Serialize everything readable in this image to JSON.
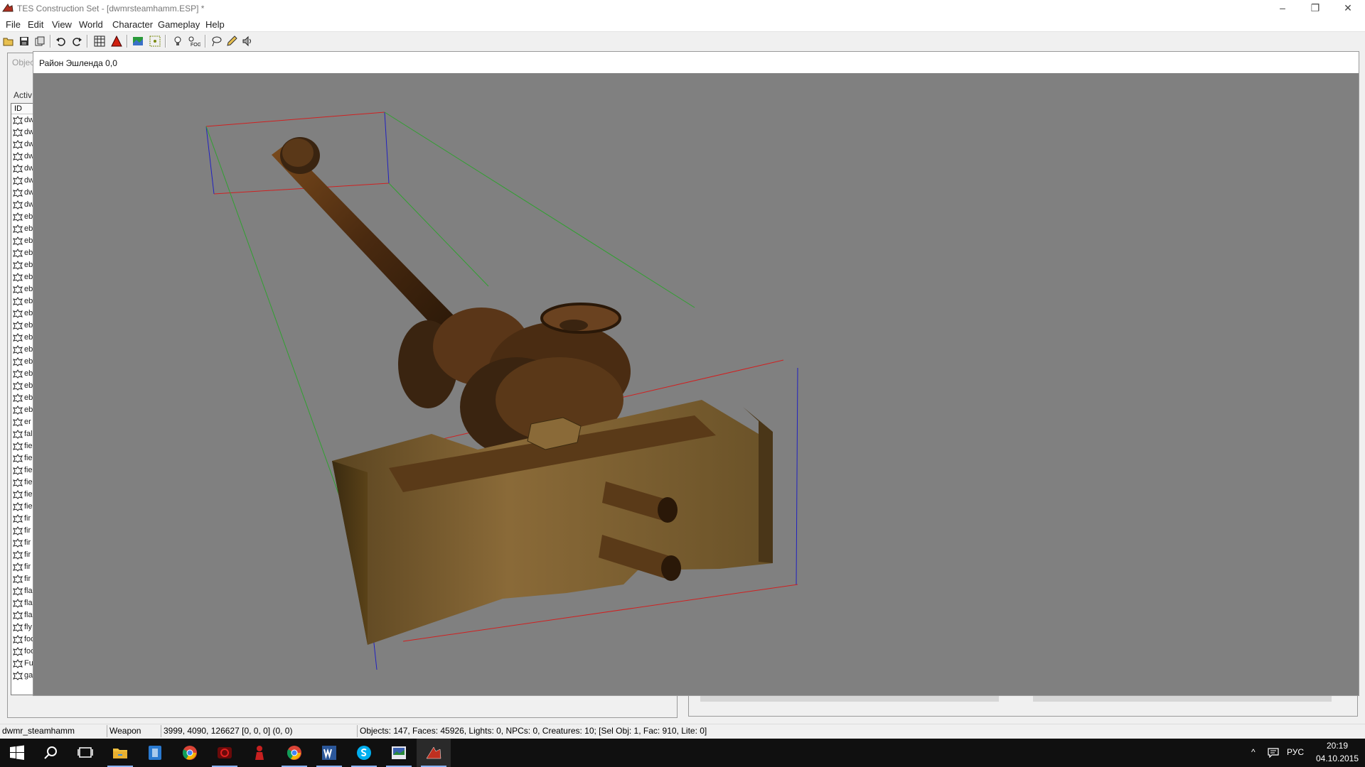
{
  "window": {
    "title": "TES Construction Set - [dwmrsteamhamm.ESP] *",
    "app_icon": "tes-cs-icon",
    "controls": {
      "minimize": "–",
      "maximize": "❐",
      "close": "✕"
    }
  },
  "menu": [
    "File",
    "Edit",
    "View",
    "World",
    "Character",
    "Gameplay",
    "Help"
  ],
  "toolbar": {
    "buttons": [
      "open-icon",
      "save-icon",
      "data-files-icon",
      "undo-icon",
      "redo-icon",
      "grid-icon",
      "landscape-edit-icon",
      "render-window-icon",
      "path-grid-icon",
      "light-icon",
      "fog-icon",
      "lasso-icon",
      "pencil-icon",
      "sound-icon"
    ]
  },
  "object_window": {
    "tab_label": "Objec",
    "sub_label": "Activ",
    "column_id": "ID",
    "rows": [
      "dw",
      "dw",
      "dw",
      "dw",
      "dw",
      "dw",
      "dw",
      "dw",
      "eb",
      "eb",
      "eb",
      "eb",
      "eb",
      "eb",
      "eb",
      "eb",
      "eb",
      "eb",
      "eb",
      "eb",
      "eb",
      "eb",
      "eb",
      "eb",
      "eb",
      "er",
      "fal",
      "fie",
      "fie",
      "fie",
      "fie",
      "fie",
      "fie",
      "fir",
      "fir",
      "fir",
      "fir",
      "fir",
      "fir",
      "fla",
      "fla",
      "fla",
      "fly",
      "foo",
      "foo",
      "Fu",
      "ga"
    ]
  },
  "render_window": {
    "title": "Район Эшленда 0,0",
    "background": "#808080"
  },
  "statusbar": {
    "object_id": "dwmr_steamhamm",
    "object_type": "Weapon",
    "coords": "3999, 4090, 126627 [0, 0, 0] (0, 0)",
    "stats": "Objects: 147, Faces: 45926, Lights: 0, NPCs: 0, Creatures: 10; [Sel Obj: 1, Fac: 910, Lite: 0]"
  },
  "taskbar": {
    "apps": [
      "windows-start-icon",
      "search-icon",
      "task-view-icon",
      "file-explorer-icon",
      "blue-app-icon",
      "chrome-icon",
      "red-app-icon",
      "figure-app-icon",
      "chrome-icon-2",
      "word-icon",
      "skype-icon",
      "photo-app-icon",
      "tes-cs-taskbar-icon"
    ],
    "language": "РУС",
    "time": "20:19",
    "date": "04.10.2015"
  }
}
